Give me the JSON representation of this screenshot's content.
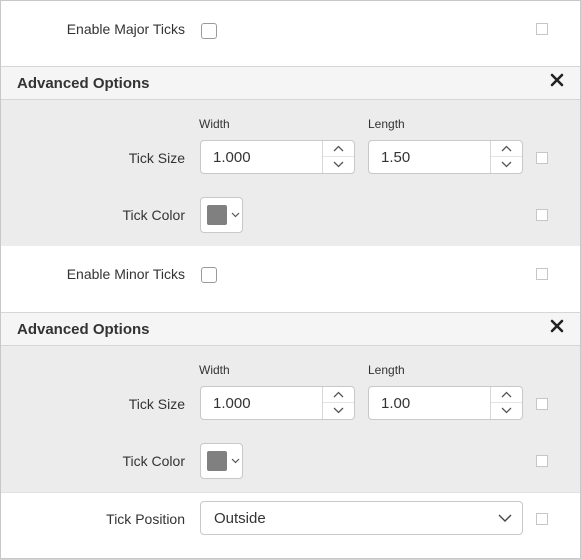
{
  "major": {
    "enable_label": "Enable Major Ticks",
    "enabled": false,
    "advanced_title": "Advanced Options",
    "width_label": "Width",
    "length_label": "Length",
    "tick_size_label": "Tick Size",
    "width_value": "1.000",
    "length_value": "1.50",
    "tick_color_label": "Tick Color",
    "tick_color": "#808080"
  },
  "minor": {
    "enable_label": "Enable Minor Ticks",
    "enabled": false,
    "advanced_title": "Advanced Options",
    "width_label": "Width",
    "length_label": "Length",
    "tick_size_label": "Tick Size",
    "width_value": "1.000",
    "length_value": "1.00",
    "tick_color_label": "Tick Color",
    "tick_color": "#808080"
  },
  "tick_position": {
    "label": "Tick Position",
    "selected": "Outside"
  },
  "icons": {
    "close": "close-icon",
    "spin_up": "chevron-up-icon",
    "spin_down": "chevron-down-icon",
    "dropdown": "chevron-down-icon"
  },
  "colors": {
    "header_bg": "#f5f5f5",
    "band_bg": "#ececec",
    "border": "#c8c8c8"
  }
}
